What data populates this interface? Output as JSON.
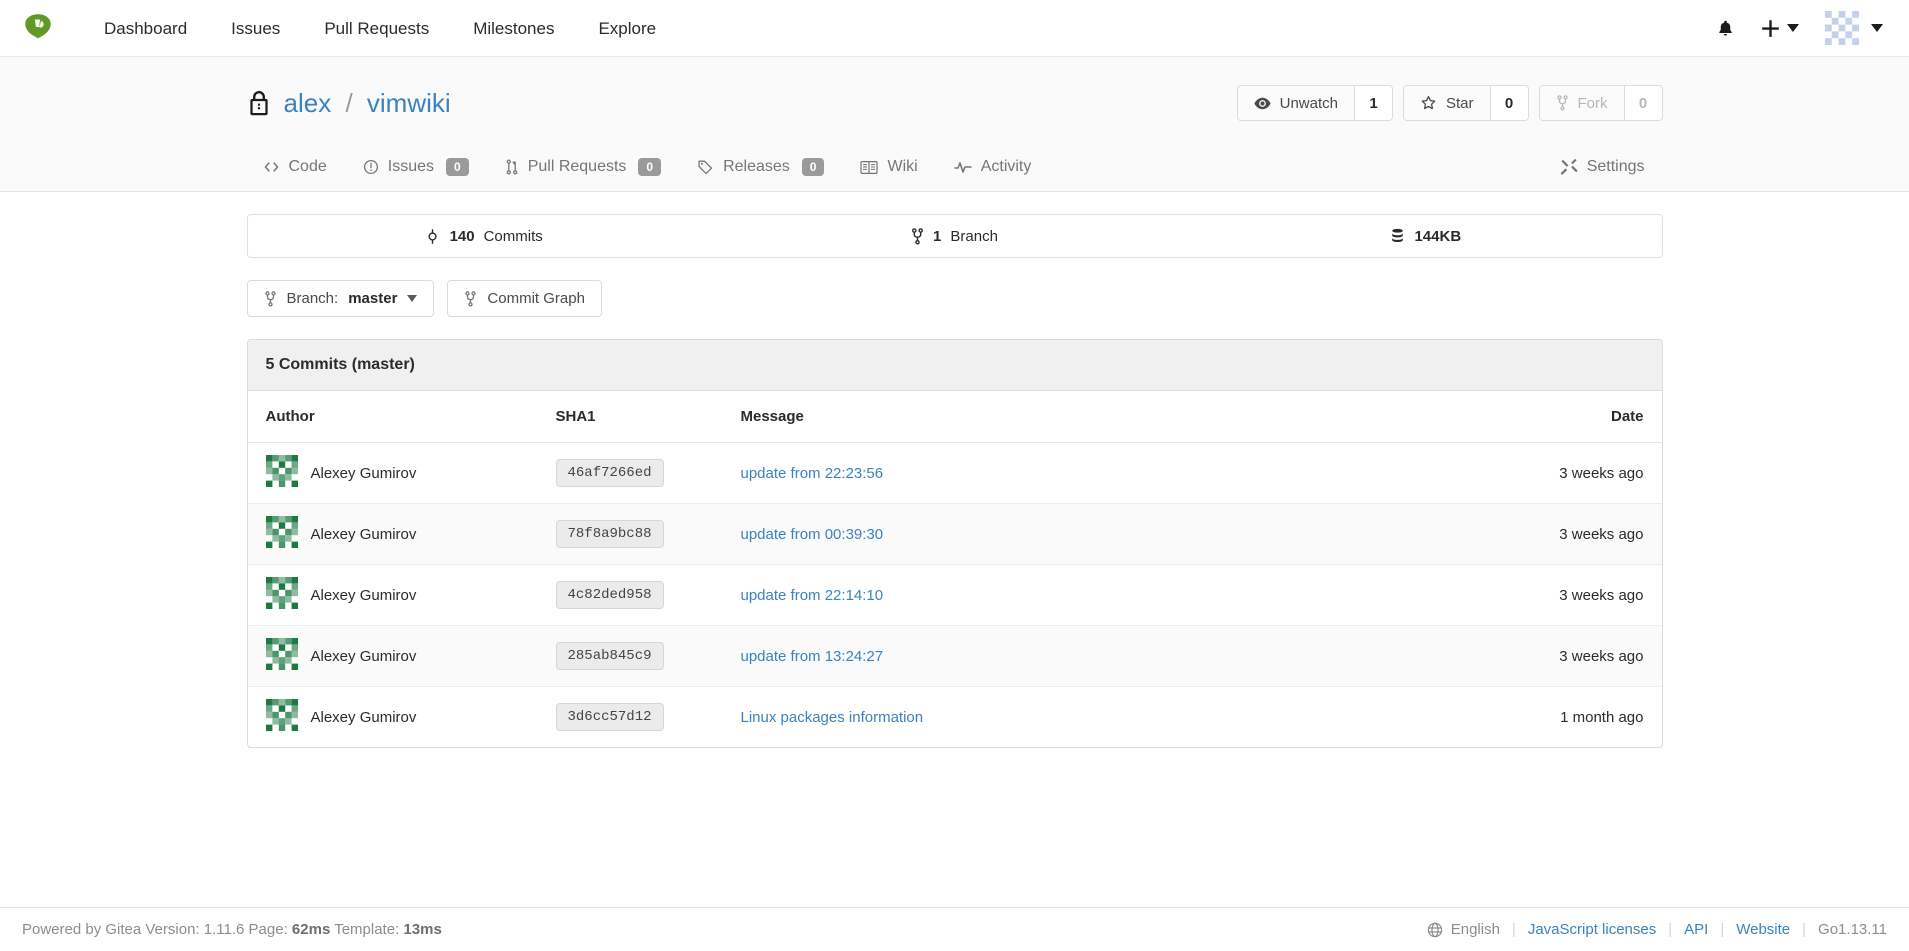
{
  "navbar": {
    "logo_icon": "gitea-logo-icon",
    "links": [
      {
        "label": "Dashboard"
      },
      {
        "label": "Issues"
      },
      {
        "label": "Pull Requests"
      },
      {
        "label": "Milestones"
      },
      {
        "label": "Explore"
      }
    ],
    "bell_icon": "bell-icon",
    "plus_icon": "plus-icon",
    "avatar_icon": "user-avatar-identicon"
  },
  "repo": {
    "lock_icon": "lock-icon",
    "owner": "alex",
    "separator": "/",
    "name": "vimwiki",
    "actions": {
      "watch_label": "Unwatch",
      "watch_count": "1",
      "watch_icon": "eye-icon",
      "star_label": "Star",
      "star_count": "0",
      "star_icon": "star-icon",
      "fork_label": "Fork",
      "fork_count": "0",
      "fork_icon": "fork-icon"
    },
    "tabs": [
      {
        "label": "Code",
        "icon": "code-icon",
        "badge": null
      },
      {
        "label": "Issues",
        "icon": "issue-opened-icon",
        "badge": "0"
      },
      {
        "label": "Pull Requests",
        "icon": "git-pull-request-icon",
        "badge": "0"
      },
      {
        "label": "Releases",
        "icon": "tag-icon",
        "badge": "0"
      },
      {
        "label": "Wiki",
        "icon": "book-icon",
        "badge": null
      },
      {
        "label": "Activity",
        "icon": "pulse-icon",
        "badge": null
      }
    ],
    "settings_tab": {
      "label": "Settings",
      "icon": "tools-icon"
    }
  },
  "stats": [
    {
      "icon": "commit-icon",
      "value": "140",
      "label": "Commits"
    },
    {
      "icon": "branch-icon",
      "value": "1",
      "label": "Branch"
    },
    {
      "icon": "database-icon",
      "value": "144KB",
      "label": ""
    }
  ],
  "toolbar": {
    "branch_prefix": "Branch:",
    "branch_name": "master",
    "branch_icon": "branch-icon",
    "commit_graph_label": "Commit Graph",
    "commit_graph_icon": "branch-icon"
  },
  "commits_panel": {
    "title": "5 Commits (master)",
    "columns": {
      "author": "Author",
      "sha": "SHA1",
      "message": "Message",
      "date": "Date"
    },
    "rows": [
      {
        "author": "Alexey Gumirov",
        "sha": "46af7266ed",
        "message": "update from 22:23:56",
        "date": "3 weeks ago"
      },
      {
        "author": "Alexey Gumirov",
        "sha": "78f8a9bc88",
        "message": "update from 00:39:30",
        "date": "3 weeks ago"
      },
      {
        "author": "Alexey Gumirov",
        "sha": "4c82ded958",
        "message": "update from 22:14:10",
        "date": "3 weeks ago"
      },
      {
        "author": "Alexey Gumirov",
        "sha": "285ab845c9",
        "message": "update from 13:24:27",
        "date": "3 weeks ago"
      },
      {
        "author": "Alexey Gumirov",
        "sha": "3d6cc57d12",
        "message": "Linux packages information",
        "date": "1 month ago"
      }
    ]
  },
  "footer": {
    "powered_prefix": "Powered by Gitea Version:",
    "version": "1.11.6",
    "page_label": "Page:",
    "page_time": "62ms",
    "template_label": "Template:",
    "template_time": "13ms",
    "language_icon": "globe-icon",
    "language": "English",
    "js_licenses": "JavaScript licenses",
    "api": "API",
    "website": "Website",
    "go_version": "Go1.13.11"
  },
  "colors": {
    "link": "#3b83c0",
    "brand_green": "#4b8b3b",
    "muted": "#767676"
  }
}
